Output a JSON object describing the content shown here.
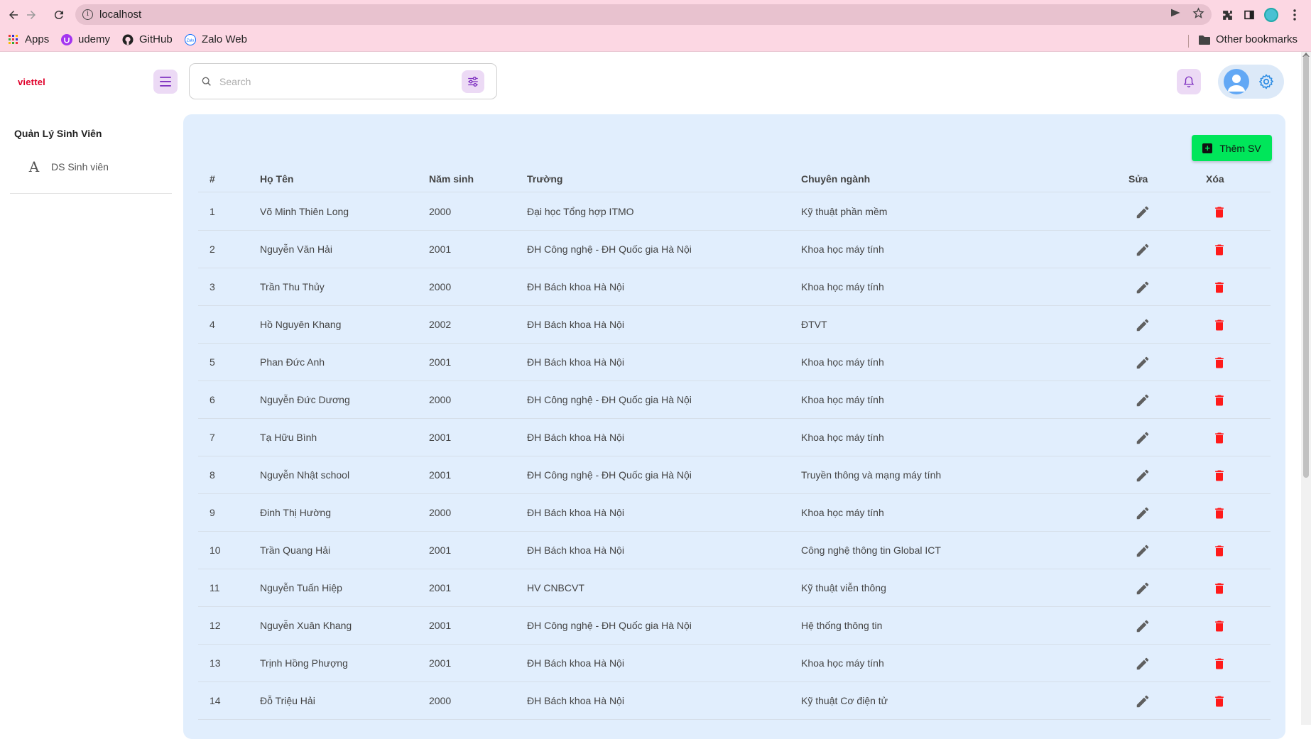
{
  "browser": {
    "url": "localhost",
    "bookmarks": [
      {
        "label": "Apps",
        "icon": "apps-grid-icon"
      },
      {
        "label": "udemy",
        "icon": "udemy-icon"
      },
      {
        "label": "GitHub",
        "icon": "github-icon"
      },
      {
        "label": "Zalo Web",
        "icon": "zalo-icon"
      }
    ],
    "other_bookmarks": "Other bookmarks"
  },
  "header": {
    "logo": "viettel",
    "search_placeholder": "Search"
  },
  "sidebar": {
    "section_title": "Quản Lý Sinh Viên",
    "items": [
      {
        "label": "DS Sinh viên",
        "icon": "font-a-icon"
      }
    ]
  },
  "main": {
    "add_button_label": "Thêm SV",
    "columns": [
      "#",
      "Họ Tên",
      "Năm sinh",
      "Trường",
      "Chuyên ngành",
      "Sửa",
      "Xóa"
    ],
    "rows": [
      [
        "1",
        "Võ Minh Thiên Long",
        "2000",
        "Đại học Tổng hợp ITMO",
        "Kỹ thuật phần mềm"
      ],
      [
        "2",
        "Nguyễn Văn Hải",
        "2001",
        "ĐH Công nghệ - ĐH Quốc gia Hà Nội",
        "Khoa học máy tính"
      ],
      [
        "3",
        "Trần Thu Thủy",
        "2000",
        "ĐH Bách khoa Hà Nội",
        "Khoa học máy tính"
      ],
      [
        "4",
        "Hồ Nguyên Khang",
        "2002",
        "ĐH Bách khoa Hà Nội",
        "ĐTVT"
      ],
      [
        "5",
        "Phan Đức Anh",
        "2001",
        "ĐH Bách khoa Hà Nội",
        "Khoa học máy tính"
      ],
      [
        "6",
        "Nguyễn Đức Dương",
        "2000",
        "ĐH Công nghệ - ĐH Quốc gia Hà Nội",
        "Khoa học máy tính"
      ],
      [
        "7",
        "Tạ Hữu Bình",
        "2001",
        "ĐH Bách khoa Hà Nội",
        "Khoa học máy tính"
      ],
      [
        "8",
        "Nguyễn Nhật school",
        "2001",
        "ĐH Công nghệ - ĐH Quốc gia Hà Nội",
        "Truyền thông và mạng máy tính"
      ],
      [
        "9",
        "Đinh Thị Hường",
        "2000",
        "ĐH Bách khoa Hà Nội",
        "Khoa học máy tính"
      ],
      [
        "10",
        "Trần Quang Hải",
        "2001",
        "ĐH Bách khoa Hà Nội",
        "Công nghệ thông tin Global ICT"
      ],
      [
        "11",
        "Nguyễn Tuấn Hiệp",
        "2001",
        "HV CNBCVT",
        "Kỹ thuật viễn thông"
      ],
      [
        "12",
        "Nguyễn Xuân Khang",
        "2001",
        "ĐH Công nghệ - ĐH Quốc gia Hà Nội",
        "Hệ thống thông tin"
      ],
      [
        "13",
        "Trịnh Hồng Phượng",
        "2001",
        "ĐH Bách khoa Hà Nội",
        "Khoa học máy tính"
      ],
      [
        "14",
        "Đỗ Triệu Hải",
        "2000",
        "ĐH Bách khoa Hà Nội",
        "Kỹ thuật Cơ điện tử"
      ]
    ]
  },
  "colors": {
    "chrome_bg": "#fcd7e3",
    "panel_bg": "#e1eefd",
    "accent_purple": "#ecdaf5",
    "add_button": "#00e65a",
    "delete_red": "#ff1a1a",
    "edit_gray": "#5f5f5f"
  }
}
